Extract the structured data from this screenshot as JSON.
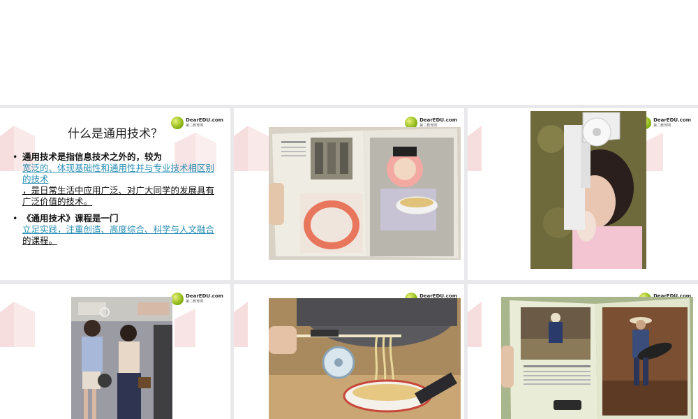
{
  "logo": {
    "brand": "DearEDU.com",
    "sub": "第二教育网"
  },
  "slide1": {
    "title": "什么是通用技术？",
    "bullets": [
      {
        "marker": "•",
        "lead": "通用技术是指信息技术之外的，较为",
        "link": "宽泛的、体现基础性和通用性并与专业技术相区别的技术",
        "tail": "，是日常生活中应用广泛、对广大同学的发展具有广泛价值的技术。"
      },
      {
        "marker": "•",
        "lead": "《通用技术》课程是一门",
        "link": "立足实践，注重创造、高度综合、科学与人文融合",
        "tail": "的课程。"
      }
    ]
  },
  "photos": {
    "book_face_shield": "book-face-shield-photo",
    "tissue_hat": "tissue-roll-hat-photo",
    "subway_chin_rest": "subway-chin-rest-photo",
    "noodle_fan": "noodle-fan-chopsticks-photo",
    "book_gardener": "book-portable-seat-photo"
  },
  "colors": {
    "link": "#2a8fb5",
    "background": "#e9e9ec",
    "logo_green": "#8fb818"
  }
}
